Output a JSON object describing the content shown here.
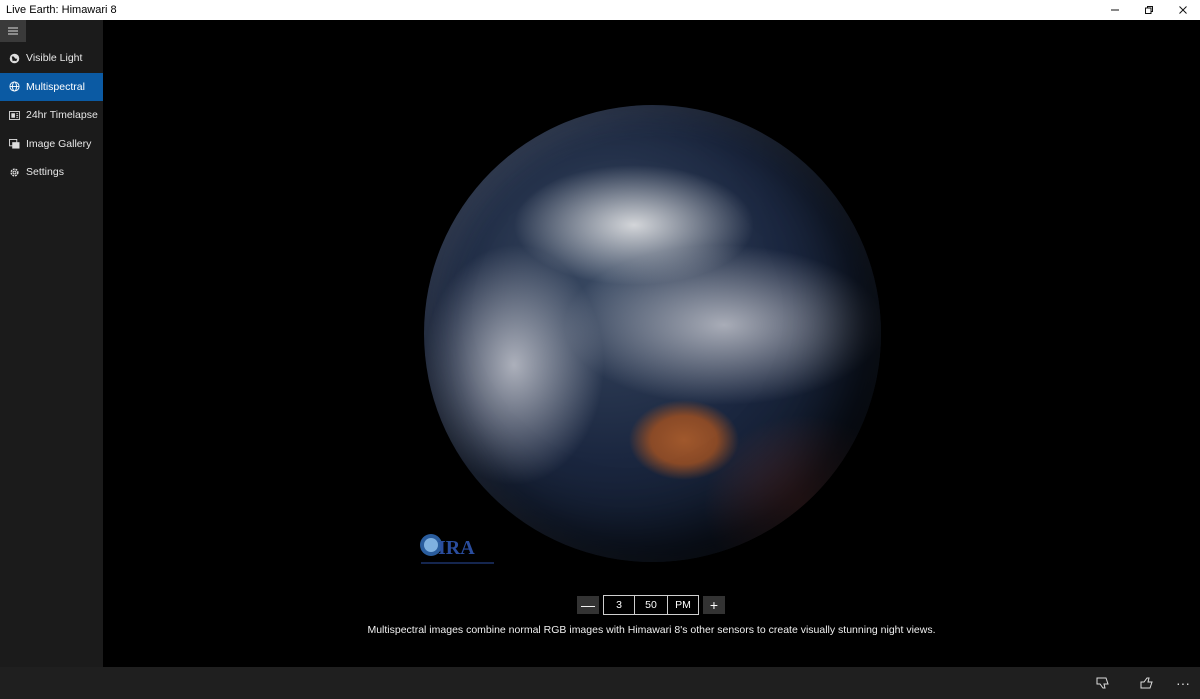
{
  "window": {
    "title": "Live Earth: Himawari 8",
    "minimize_icon": "minimize-icon",
    "restore_icon": "restore-icon",
    "close_icon": "close-icon"
  },
  "sidebar": {
    "menu_icon": "hamburger-icon",
    "items": [
      {
        "label": "Visible Light",
        "icon": "globe-icon",
        "active": false
      },
      {
        "label": "Multispectral",
        "icon": "world-icon",
        "active": true
      },
      {
        "label": "24hr Timelapse",
        "icon": "video-icon",
        "active": false
      },
      {
        "label": "Image Gallery",
        "icon": "gallery-icon",
        "active": false
      },
      {
        "label": "Settings",
        "icon": "gear-icon",
        "active": false
      }
    ]
  },
  "main": {
    "logo_text": "CIRA",
    "time_picker": {
      "hour": "3",
      "minute": "50",
      "ampm": "PM",
      "decrement_label": "—",
      "increment_label": "+"
    },
    "caption": "Multispectral images combine normal RGB images with Himawari 8's other sensors to create visually stunning night views."
  },
  "bottombar": {
    "feedback_icon": "dislike-icon",
    "like_icon": "like-icon",
    "more_label": "···"
  },
  "colors": {
    "accent": "#0b5aa3",
    "sidebar_bg": "#1b1b1b",
    "bottombar_bg": "#1f1f1f"
  }
}
